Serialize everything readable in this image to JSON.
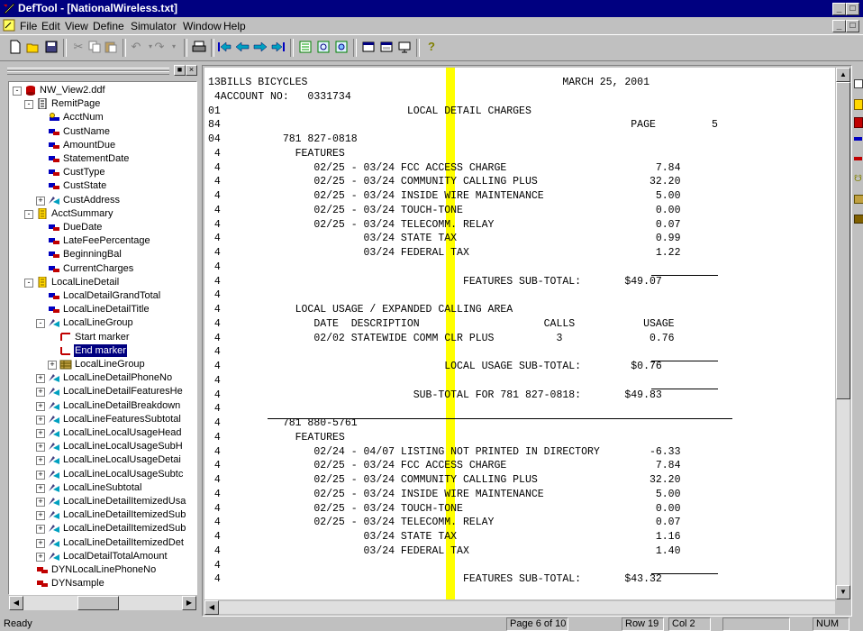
{
  "window": {
    "title": "DefTool - [NationalWireless.txt]"
  },
  "menu": [
    "File",
    "Edit",
    "View",
    "Define",
    "Simulator",
    "Window",
    "Help"
  ],
  "toolbar": {
    "buttons": [
      "new-icon",
      "open-icon",
      "save-icon",
      "cut-icon",
      "copy-icon",
      "paste-icon",
      "undo-icon",
      "redo-icon",
      "print-icon",
      "first-page-icon",
      "prev-page-icon",
      "next-page-icon",
      "last-page-icon",
      "list-icon",
      "zoom-icon",
      "zoom-fit-icon",
      "window-icon",
      "window2-icon",
      "properties-icon",
      "help-icon"
    ]
  },
  "tree": {
    "root": "NW_View2.ddf",
    "nodes": [
      {
        "label": "NW_View2.ddf",
        "level": 0,
        "icon": "db",
        "exp": "-"
      },
      {
        "label": "RemitPage",
        "level": 1,
        "icon": "page",
        "exp": "-"
      },
      {
        "label": "AcctNum",
        "level": 2,
        "icon": "fieldkey",
        "exp": ""
      },
      {
        "label": "CustName",
        "level": 2,
        "icon": "field",
        "exp": ""
      },
      {
        "label": "AmountDue",
        "level": 2,
        "icon": "field",
        "exp": ""
      },
      {
        "label": "StatementDate",
        "level": 2,
        "icon": "field",
        "exp": ""
      },
      {
        "label": "CustType",
        "level": 2,
        "icon": "field",
        "exp": ""
      },
      {
        "label": "CustState",
        "level": 2,
        "icon": "field",
        "exp": ""
      },
      {
        "label": "CustAddress",
        "level": 2,
        "icon": "group",
        "exp": "+"
      },
      {
        "label": "AcctSummary",
        "level": 1,
        "icon": "yellowpage",
        "exp": "-"
      },
      {
        "label": "DueDate",
        "level": 2,
        "icon": "field",
        "exp": ""
      },
      {
        "label": "LateFeePercentage",
        "level": 2,
        "icon": "field",
        "exp": ""
      },
      {
        "label": "BeginningBal",
        "level": 2,
        "icon": "field",
        "exp": ""
      },
      {
        "label": "CurrentCharges",
        "level": 2,
        "icon": "field",
        "exp": ""
      },
      {
        "label": "LocalLineDetail",
        "level": 1,
        "icon": "yellowpage",
        "exp": "-"
      },
      {
        "label": "LocalDetailGrandTotal",
        "level": 2,
        "icon": "field",
        "exp": ""
      },
      {
        "label": "LocalLineDetailTitle",
        "level": 2,
        "icon": "field",
        "exp": ""
      },
      {
        "label": "LocalLineGroup",
        "level": 2,
        "icon": "group",
        "exp": "-"
      },
      {
        "label": "Start marker",
        "level": 3,
        "icon": "startmarker",
        "exp": ""
      },
      {
        "label": "End marker",
        "level": 3,
        "icon": "endmarker",
        "exp": "",
        "selected": true
      },
      {
        "label": "LocalLineGroup",
        "level": 3,
        "icon": "table",
        "exp": "+"
      },
      {
        "label": "LocalLineDetailPhoneNo",
        "level": 2,
        "icon": "group",
        "exp": "+"
      },
      {
        "label": "LocalLineDetailFeaturesHe",
        "level": 2,
        "icon": "group",
        "exp": "+"
      },
      {
        "label": "LocalLineDetailBreakdown",
        "level": 2,
        "icon": "group",
        "exp": "+"
      },
      {
        "label": "LocalLineFeaturesSubtotal",
        "level": 2,
        "icon": "group",
        "exp": "+"
      },
      {
        "label": "LocalLineLocalUsageHead",
        "level": 2,
        "icon": "group",
        "exp": "+"
      },
      {
        "label": "LocalLineLocalUsageSubH",
        "level": 2,
        "icon": "group",
        "exp": "+"
      },
      {
        "label": "LocalLineLocalUsageDetai",
        "level": 2,
        "icon": "group",
        "exp": "+"
      },
      {
        "label": "LocalLineLocalUsageSubtc",
        "level": 2,
        "icon": "group",
        "exp": "+"
      },
      {
        "label": "LocalLineSubtotal",
        "level": 2,
        "icon": "group",
        "exp": "+"
      },
      {
        "label": "LocalLineDetailItemizedUsa",
        "level": 2,
        "icon": "group",
        "exp": "+"
      },
      {
        "label": "LocalLineDetailItemizedSub",
        "level": 2,
        "icon": "group",
        "exp": "+"
      },
      {
        "label": "LocalLineDetailItemizedSub",
        "level": 2,
        "icon": "group",
        "exp": "+"
      },
      {
        "label": "LocalLineDetailItemizedDet",
        "level": 2,
        "icon": "group",
        "exp": "+"
      },
      {
        "label": "LocalDetailTotalAmount",
        "level": 2,
        "icon": "group",
        "exp": "+"
      },
      {
        "label": "DYNLocalLinePhoneNo",
        "level": 1,
        "icon": "dynfield",
        "exp": ""
      },
      {
        "label": "DYNsample",
        "level": 1,
        "icon": "dynfield",
        "exp": ""
      }
    ]
  },
  "document": {
    "lines": [
      "13BILLS BICYCLES                                         MARCH 25, 2001",
      " 4ACCOUNT NO:   0331734",
      "01                              LOCAL DETAIL CHARGES",
      "84                                                                  PAGE         5",
      "04          781 827-0818",
      " 4            FEATURES",
      " 4               02/25 - 03/24 FCC ACCESS CHARGE                        7.84",
      " 4               02/25 - 03/24 COMMUNITY CALLING PLUS                  32.20",
      " 4               02/25 - 03/24 INSIDE WIRE MAINTENANCE                  5.00",
      " 4               02/25 - 03/24 TOUCH-TONE                               0.00",
      " 4               02/25 - 03/24 TELECOMM. RELAY                          0.07",
      " 4                       03/24 STATE TAX                                0.99",
      " 4                       03/24 FEDERAL TAX                              1.22",
      " 4",
      " 4                                       FEATURES SUB-TOTAL:       $49.07",
      " 4",
      " 4            LOCAL USAGE / EXPANDED CALLING AREA",
      " 4               DATE  DESCRIPTION                    CALLS           USAGE",
      " 4               02/02 STATEWIDE COMM CLR PLUS          3              0.76",
      " 4",
      " 4                                    LOCAL USAGE SUB-TOTAL:        $0.76",
      " 4",
      " 4                               SUB-TOTAL FOR 781 827-0818:       $49.83",
      " 4",
      " 4          781 880-5761",
      " 4            FEATURES",
      " 4               02/24 - 04/07 LISTING NOT PRINTED IN DIRECTORY        -6.33",
      " 4               02/25 - 03/24 FCC ACCESS CHARGE                        7.84",
      " 4               02/25 - 03/24 COMMUNITY CALLING PLUS                  32.20",
      " 4               02/25 - 03/24 INSIDE WIRE MAINTENANCE                  5.00",
      " 4               02/25 - 03/24 TOUCH-TONE                               0.00",
      " 4               02/25 - 03/24 TELECOMM. RELAY                          0.07",
      " 4                       03/24 STATE TAX                                1.16",
      " 4                       03/24 FEDERAL TAX                              1.40",
      " 4",
      " 4                                       FEATURES SUB-TOTAL:       $43.32"
    ]
  },
  "status": {
    "ready": "Ready",
    "page": "Page 6 of 10",
    "row": "Row 19",
    "col": "Col 2",
    "num": "NUM"
  },
  "colors": {
    "title_bg": "#000080",
    "highlight_column": "#ffff00",
    "selection": "#000080"
  }
}
